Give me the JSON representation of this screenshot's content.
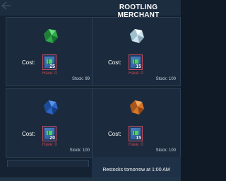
{
  "window": {
    "title": "ROOTLING MERCHANT"
  },
  "items": [
    {
      "gem": "green-gem-icon",
      "gem_color": "#2faa4a",
      "cost_label": "Cost:",
      "cost_qty": "25",
      "have_text": "Have: 0",
      "stock_text": "Stock: 99"
    },
    {
      "gem": "white-gem-icon",
      "gem_color": "#cfe4ee",
      "cost_label": "Cost:",
      "cost_qty": "15",
      "have_text": "Have: 0",
      "stock_text": "Stock: 100"
    },
    {
      "gem": "blue-gem-icon",
      "gem_color": "#2a66c8",
      "cost_label": "Cost:",
      "cost_qty": "20",
      "have_text": "Have: 0",
      "stock_text": "Stock: 100"
    },
    {
      "gem": "orange-gem-icon",
      "gem_color": "#d8772a",
      "cost_label": "Cost:",
      "cost_qty": "15",
      "have_text": "Have: 0",
      "stock_text": "Stock: 100"
    }
  ],
  "footer": {
    "restock_text": "Restocks tomorrow at 1:00 AM"
  },
  "colors": {
    "have_text": "#c04b57",
    "token_border": "#c04a5a",
    "token_fill": "#2b5b99",
    "panel_bg": "#1b2b3d"
  }
}
